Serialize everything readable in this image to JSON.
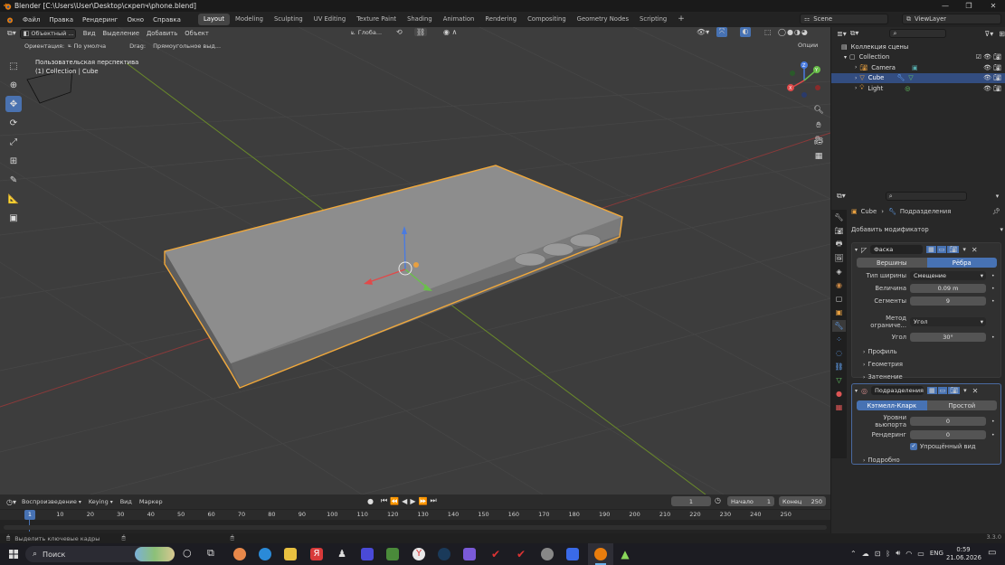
{
  "window": {
    "title": "Blender [C:\\Users\\User\\Desktop\\скрепч\\phone.blend]"
  },
  "menubar": {
    "menus": [
      "Файл",
      "Правка",
      "Рендеринг",
      "Окно",
      "Справка"
    ],
    "workspaces": [
      "Layout",
      "Modeling",
      "Sculpting",
      "UV Editing",
      "Texture Paint",
      "Shading",
      "Animation",
      "Rendering",
      "Compositing",
      "Geometry Nodes",
      "Scripting"
    ],
    "active_workspace": "Layout",
    "add_tab": "+",
    "scene": "Scene",
    "view_layer": "ViewLayer"
  },
  "viewport": {
    "mode": "Объектный ...",
    "menus": [
      "Вид",
      "Выделение",
      "Добавить",
      "Объект"
    ],
    "transform_orientation": "Глоба...",
    "orientation_label": "Ориентация:",
    "orientation_value": "По умолча",
    "drag_label": "Drag:",
    "drag_value": "Прямоугольное выд...",
    "options": "Опции",
    "overlay_line1": "Пользовательская перспектива",
    "overlay_line2": "(1) Collection | Cube",
    "gizmo": {
      "x": "X",
      "y": "Y",
      "z": "Z"
    }
  },
  "outliner": {
    "search_placeholder": "",
    "root": "Коллекция сцены",
    "collection": "Collection",
    "items": [
      {
        "name": "Camera",
        "selected": false
      },
      {
        "name": "Cube",
        "selected": true
      },
      {
        "name": "Light",
        "selected": false
      }
    ]
  },
  "properties": {
    "breadcrumb_object": "Cube",
    "breadcrumb_modifier": "Подразделения",
    "add_modifier": "Добавить модификатор",
    "bevel": {
      "name": "Фаска",
      "affect_options": [
        "Вершины",
        "Рёбра"
      ],
      "affect_active": "Рёбра",
      "width_type_label": "Тип ширины",
      "width_type_value": "Смещение",
      "amount_label": "Величина",
      "amount_value": "0.09 m",
      "segments_label": "Сегменты",
      "segments_value": "9",
      "limit_label": "Метод ограниче...",
      "limit_value": "Угол",
      "angle_label": "Угол",
      "angle_value": "30°",
      "subpanels": [
        "Профиль",
        "Геометрия",
        "Затенение"
      ]
    },
    "subsurf": {
      "name": "Подразделения",
      "type_options": [
        "Кэтмелл-Кларк",
        "Простой"
      ],
      "type_active": "Кэтмелл-Кларк",
      "levels_label": "Уровни вьюпорта",
      "levels_value": "0",
      "render_label": "Рендеринг",
      "render_value": "0",
      "optimal_label": "Упрощённый вид",
      "optimal_checked": true,
      "advanced": "Подробно"
    }
  },
  "timeline": {
    "playback": "Воспроизведение",
    "keying": "Keying",
    "view": "Вид",
    "marker": "Маркер",
    "current_frame": "1",
    "start_label": "Начало",
    "start_value": "1",
    "end_label": "Конец",
    "end_value": "250",
    "ruler_marks": [
      "10",
      "20",
      "30",
      "40",
      "50",
      "60",
      "70",
      "80",
      "90",
      "100",
      "110",
      "120",
      "130",
      "140",
      "150",
      "160",
      "170",
      "180",
      "190",
      "200",
      "210",
      "220",
      "230",
      "240",
      "250"
    ],
    "playhead": "1"
  },
  "statusbar": {
    "hint": "Выделить ключевые кадры",
    "version": "3.3.0"
  },
  "taskbar": {
    "search": "Поиск",
    "lang": "ENG",
    "time": "0:59",
    "date": "21.06.2026"
  }
}
